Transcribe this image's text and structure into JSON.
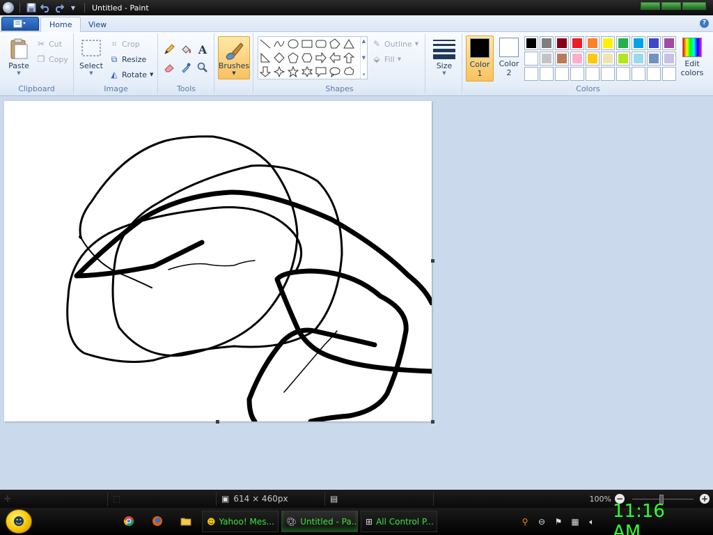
{
  "window": {
    "title": "Untitled - Paint"
  },
  "ribbon_tabs": [
    {
      "label": "Home"
    },
    {
      "label": "View"
    }
  ],
  "clipboard": {
    "group_label": "Clipboard",
    "paste": "Paste",
    "cut": "Cut",
    "copy": "Copy"
  },
  "image": {
    "group_label": "Image",
    "select": "Select",
    "crop": "Crop",
    "resize": "Resize",
    "rotate": "Rotate"
  },
  "tools": {
    "group_label": "Tools"
  },
  "brushes": {
    "label": "Brushes"
  },
  "shapes": {
    "group_label": "Shapes",
    "outline": "Outline",
    "fill": "Fill"
  },
  "size": {
    "label": "Size"
  },
  "colors": {
    "group_label": "Colors",
    "color1_line1": "Color",
    "color1_line2": "1",
    "color2_line1": "Color",
    "color2_line2": "2",
    "edit_line1": "Edit",
    "edit_line2": "colors",
    "color1_value": "#000000",
    "color2_value": "#ffffff",
    "palette_row1": [
      "#000000",
      "#7f7f7f",
      "#880015",
      "#ed1c24",
      "#ff7f27",
      "#fff200",
      "#22b14c",
      "#00a2e8",
      "#3f48cc",
      "#a349a4"
    ],
    "palette_row2": [
      "#ffffff",
      "#c3c3c3",
      "#b97a57",
      "#ffaec9",
      "#ffc90e",
      "#efe4b0",
      "#b5e61d",
      "#99d9ea",
      "#7092be",
      "#c8bfe7"
    ],
    "palette_row3": [
      "#ffffff",
      "#ffffff",
      "#ffffff",
      "#ffffff",
      "#ffffff",
      "#ffffff",
      "#ffffff",
      "#ffffff",
      "#ffffff",
      "#ffffff"
    ]
  },
  "status": {
    "dimensions": "614 × 460px",
    "zoom": "100%"
  },
  "taskbar": {
    "items": [
      {
        "label": "Yahoo! Mes..."
      },
      {
        "label": "Untitled - Pa..."
      },
      {
        "label": "All Control P..."
      }
    ],
    "clock": "11:16 AM"
  }
}
